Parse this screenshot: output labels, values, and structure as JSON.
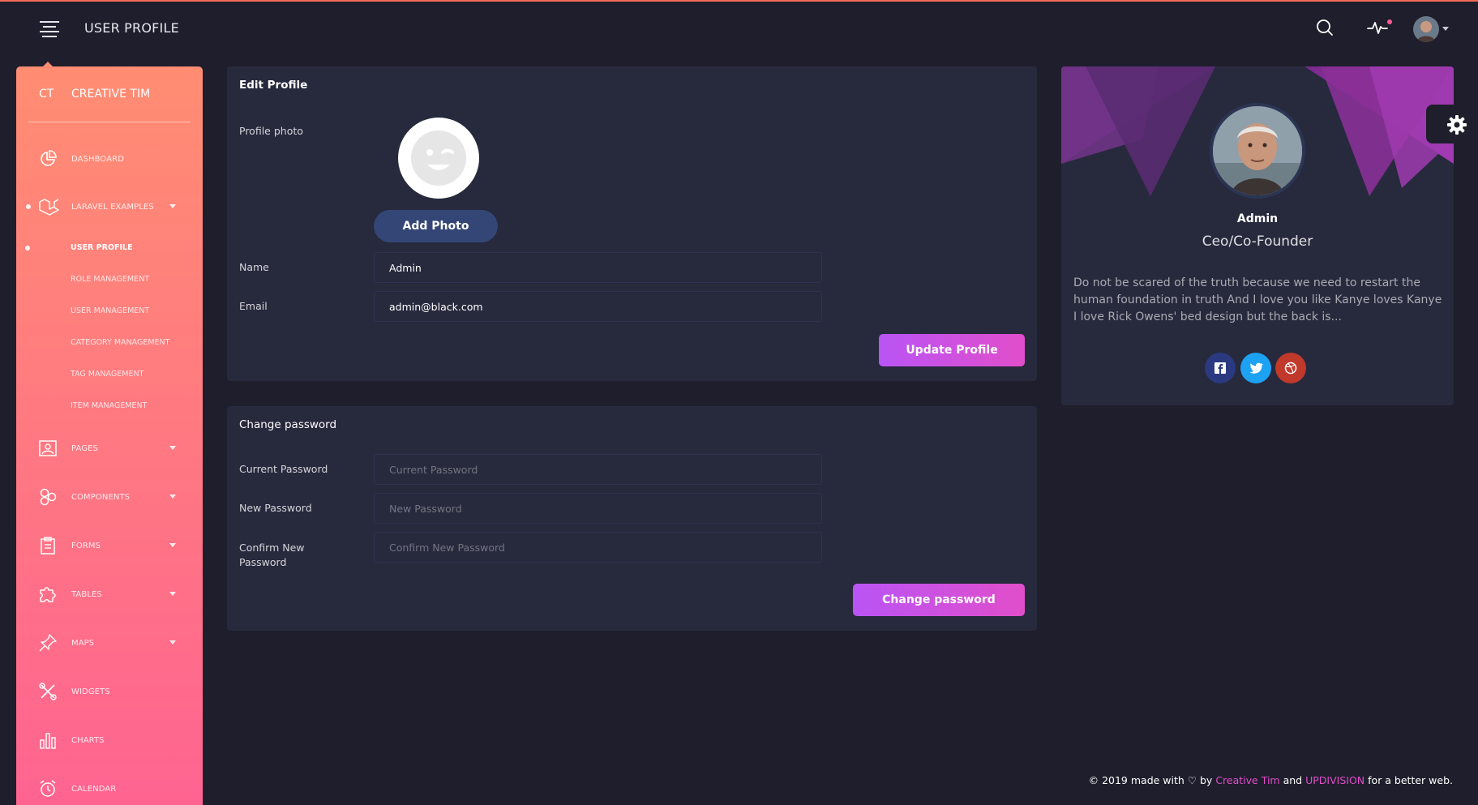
{
  "navbar": {
    "title": "USER PROFILE",
    "icons": [
      "menu-icon",
      "search-icon",
      "activity-icon",
      "avatar"
    ]
  },
  "sidebar": {
    "logo_mini": "CT",
    "logo_normal": "CREATIVE TIM",
    "items": [
      {
        "label": "DASHBOARD",
        "icon": "chart-pie-icon"
      },
      {
        "label": "LARAVEL EXAMPLES",
        "icon": "laravel-icon"
      },
      {
        "label": "PAGES",
        "icon": "image-icon"
      },
      {
        "label": "COMPONENTS",
        "icon": "components-icon"
      },
      {
        "label": "FORMS",
        "icon": "clipboard-icon"
      },
      {
        "label": "TABLES",
        "icon": "puzzle-icon"
      },
      {
        "label": "MAPS",
        "icon": "pin-icon"
      },
      {
        "label": "WIDGETS",
        "icon": "tools-icon"
      },
      {
        "label": "CHARTS",
        "icon": "bar-chart-icon"
      },
      {
        "label": "CALENDAR",
        "icon": "alarm-icon"
      }
    ],
    "subitems": [
      {
        "label": "USER PROFILE"
      },
      {
        "label": "ROLE MANAGEMENT"
      },
      {
        "label": "USER MANAGEMENT"
      },
      {
        "label": "CATEGORY MANAGEMENT"
      },
      {
        "label": "TAG MANAGEMENT"
      },
      {
        "label": "ITEM MANAGEMENT"
      }
    ]
  },
  "edit_profile": {
    "title": "Edit Profile",
    "photo_label": "Profile photo",
    "add_photo": "Add Photo",
    "name_label": "Name",
    "name_value": "Admin",
    "email_label": "Email",
    "email_value": "admin@black.com",
    "update_button": "Update Profile"
  },
  "change_password": {
    "title": "Change password",
    "current_label": "Current Password",
    "current_placeholder": "Current Password",
    "new_label": "New Password",
    "new_placeholder": "New Password",
    "confirm_label": "Confirm New Password",
    "confirm_placeholder": "Confirm New Password",
    "button": "Change password"
  },
  "profile_card": {
    "name": "Admin",
    "role": "Ceo/Co-Founder",
    "description": "Do not be scared of the truth because we need to restart the human foundation in truth And I love you like Kanye loves Kanye I love Rick Owens' bed design but the back is...",
    "social": [
      "facebook-icon",
      "twitter-icon",
      "dribbble-icon"
    ]
  },
  "footer": {
    "prefix": "© 2019 made with",
    "by": "by",
    "author1": "Creative Tim",
    "and": "and",
    "author2": "UPDIVISION",
    "suffix": "for a better web."
  },
  "colors": {
    "background": "#1e1e2c",
    "card": "#27293d",
    "sidebar_top": "#ff8d72",
    "sidebar_bottom": "#ff6491",
    "primary": "#e14eca",
    "add_photo": "#344675"
  }
}
